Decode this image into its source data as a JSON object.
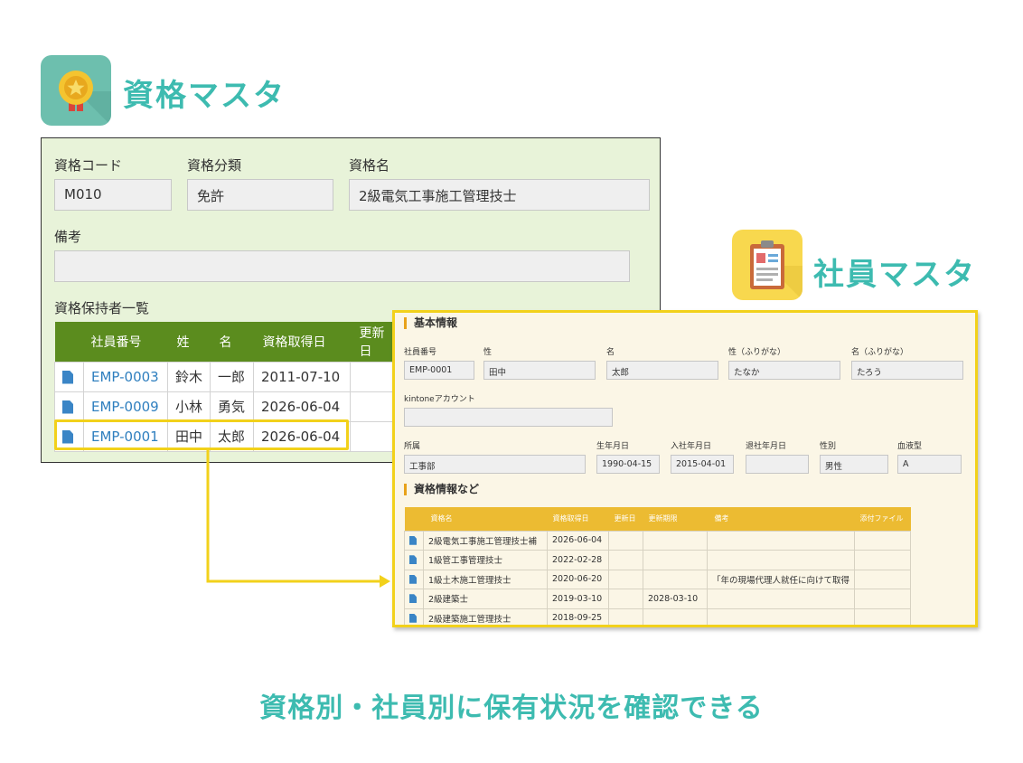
{
  "qual_app": {
    "title": "資格マスタ",
    "icon": "medal-icon",
    "icon_color": "#6dbfae"
  },
  "emp_app": {
    "title": "社員マスタ",
    "icon": "id-card-icon",
    "icon_color": "#f8d84e"
  },
  "qual_record": {
    "code_label": "資格コード",
    "code_value": "M010",
    "category_label": "資格分類",
    "category_value": "免許",
    "name_label": "資格名",
    "name_value": "2級電気工事施工管理技士",
    "notes_label": "備考",
    "notes_value": "",
    "holders_label": "資格保持者一覧",
    "holders_headers": [
      "社員番号",
      "姓",
      "名",
      "資格取得日",
      "更新日"
    ],
    "holders_rows": [
      {
        "id": "EMP-0003",
        "last": "鈴木",
        "first": "一郎",
        "date": "2011-07-10",
        "updated": ""
      },
      {
        "id": "EMP-0009",
        "last": "小林",
        "first": "勇気",
        "date": "2026-06-04",
        "updated": ""
      },
      {
        "id": "EMP-0001",
        "last": "田中",
        "first": "太郎",
        "date": "2026-06-04",
        "updated": ""
      }
    ]
  },
  "emp_record": {
    "basic_section": "基本情報",
    "emp_no_label": "社員番号",
    "emp_no_value": "EMP-0001",
    "last_label": "性",
    "last_value": "田中",
    "first_label": "名",
    "first_value": "太郎",
    "last_kana_label": "性（ふりがな）",
    "last_kana_value": "たなか",
    "first_kana_label": "名（ふりがな）",
    "first_kana_value": "たろう",
    "kintone_label": "kintoneアカウント",
    "kintone_value": "",
    "dept_label": "所属",
    "dept_value": "工事部",
    "birth_label": "生年月日",
    "birth_value": "1990-04-15",
    "join_label": "入社年月日",
    "join_value": "2015-04-01",
    "leave_label": "退社年月日",
    "leave_value": "",
    "gender_label": "性別",
    "gender_value": "男性",
    "blood_label": "血液型",
    "blood_value": "A",
    "qual_section": "資格情報など",
    "qual_headers": [
      "資格名",
      "資格取得日",
      "更新日",
      "更新期限",
      "備考",
      "添付ファイル"
    ],
    "qual_rows": [
      {
        "name": "2級電気工事施工管理技士補",
        "date": "2026-06-04",
        "updated": "",
        "deadline": "",
        "note": "",
        "file": ""
      },
      {
        "name": "1級管工事管理技士",
        "date": "2022-02-28",
        "updated": "",
        "deadline": "",
        "note": "",
        "file": ""
      },
      {
        "name": "1級土木施工管理技士",
        "date": "2020-06-20",
        "updated": "",
        "deadline": "",
        "note": "「年の現場代理人就任に向けて取得",
        "file": ""
      },
      {
        "name": "2級建築士",
        "date": "2019-03-10",
        "updated": "",
        "deadline": "2028-03-10",
        "note": "",
        "file": ""
      },
      {
        "name": "2級建築施工管理技士",
        "date": "2018-09-25",
        "updated": "",
        "deadline": "",
        "note": "",
        "file": ""
      }
    ]
  },
  "caption": "資格別・社員別に保有状況を確認できる",
  "colors": {
    "teal": "#3dbbb0",
    "green_header": "#5b8c1e",
    "yellow_header": "#ecbb32",
    "highlight": "#f2d11b"
  }
}
